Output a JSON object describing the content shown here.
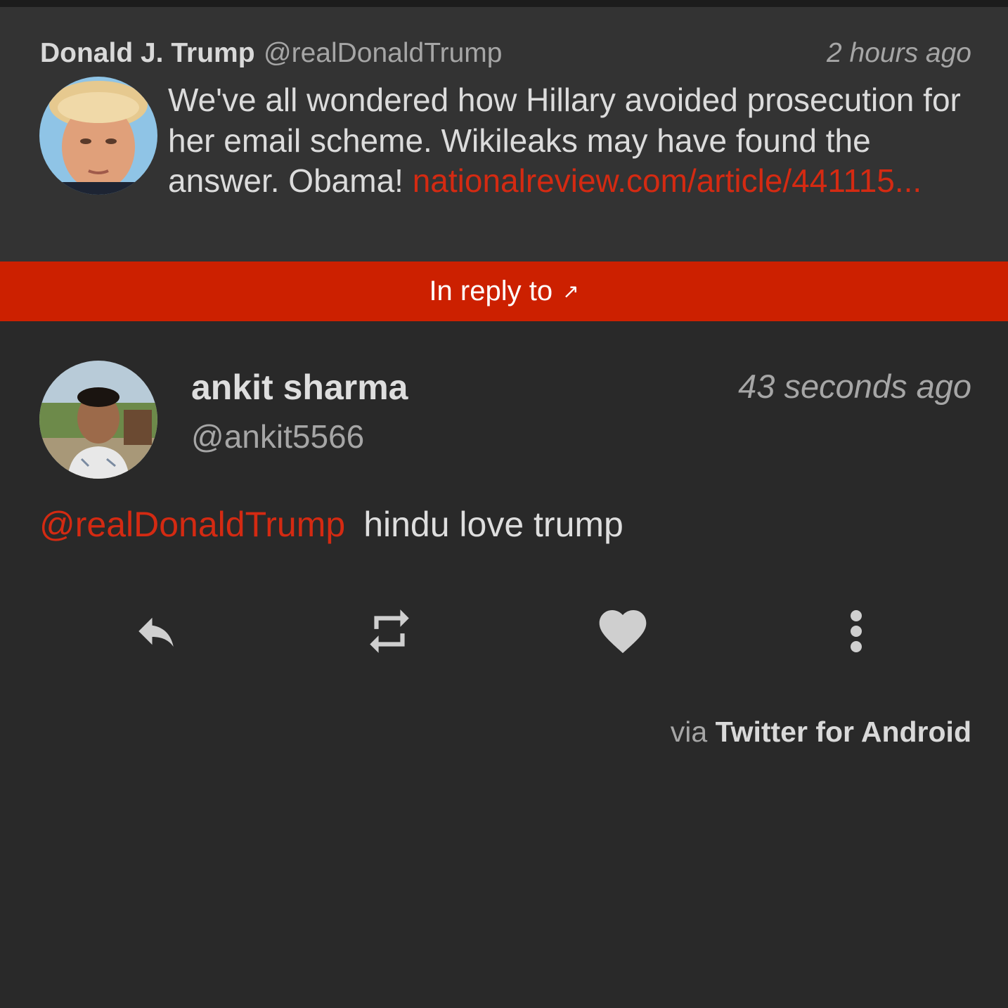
{
  "parent_tweet": {
    "name": "Donald J. Trump",
    "handle": "@realDonaldTrump",
    "time": "2 hours ago",
    "text": "We've all wondered how Hillary avoided prosecution for her email scheme. Wikileaks may have found the answer. Obama! ",
    "link": "nationalreview.com/article/441115..."
  },
  "reply_bar": {
    "label": "In reply to",
    "arrow": "↗"
  },
  "reply_tweet": {
    "name": "ankit sharma",
    "handle": "@ankit5566",
    "time": "43 seconds ago",
    "mention": "@realDonaldTrump",
    "text": "hindu love trump"
  },
  "actions": {
    "reply_icon": "reply-icon",
    "retweet_icon": "retweet-icon",
    "like_icon": "heart-icon",
    "more_icon": "more-vertical-icon"
  },
  "source": {
    "prefix": "via",
    "client": "Twitter for Android"
  },
  "colors": {
    "accent": "#cc2000",
    "link": "#d42a12",
    "background": "#292929",
    "parent_background": "#333333"
  }
}
